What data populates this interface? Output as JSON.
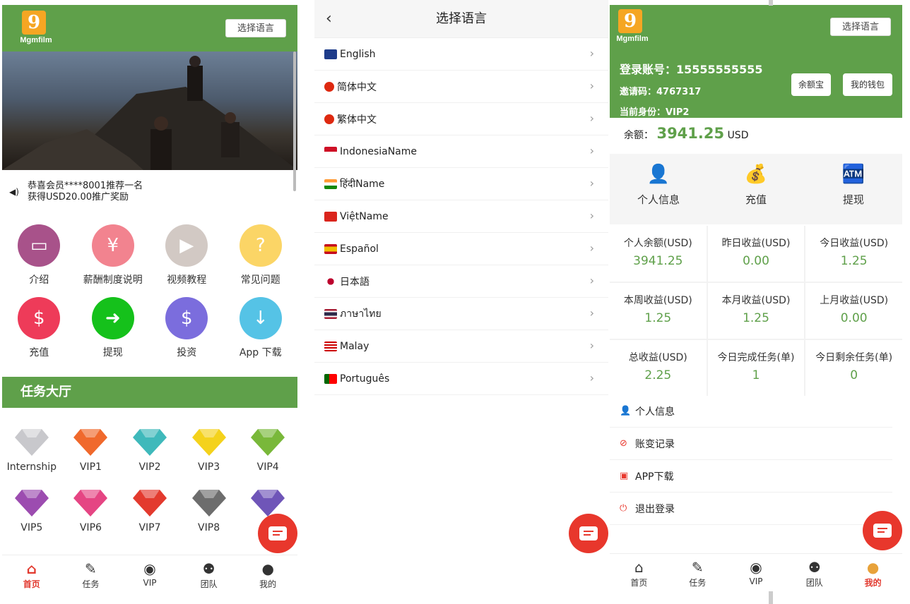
{
  "brand": {
    "logo_text": "Mgmfilm",
    "logo_glyph": "9"
  },
  "panel1": {
    "lang_button": "选择语言",
    "notice_line1": "恭喜会员****8001推荐一名",
    "notice_line2": "获得USD20.00推广奖励",
    "icons_row1": [
      {
        "label": "介绍",
        "color": "#a8528a",
        "icon": "monitor-icon",
        "glyph": "▭"
      },
      {
        "label": "薪酬制度说明",
        "color": "#f2838f",
        "icon": "salary-icon",
        "glyph": "¥"
      },
      {
        "label": "视频教程",
        "color": "#d2c9c4",
        "icon": "video-icon",
        "glyph": "▶"
      },
      {
        "label": "常见问题",
        "color": "#fbd566",
        "icon": "question-icon",
        "glyph": "?"
      }
    ],
    "icons_row2": [
      {
        "label": "充值",
        "color": "#ee3b59",
        "icon": "recharge-icon",
        "glyph": "$"
      },
      {
        "label": "提现",
        "color": "#15c11b",
        "icon": "withdraw-icon",
        "glyph": "➜"
      },
      {
        "label": "投资",
        "color": "#7b6ddd",
        "icon": "invest-icon",
        "glyph": "$"
      },
      {
        "label": "App 下载",
        "color": "#55c3e6",
        "icon": "download-icon",
        "glyph": "↓"
      }
    ],
    "section_title": "任务大厅",
    "gems_row1": [
      {
        "label": "Internship",
        "color": "#c8c8cc"
      },
      {
        "label": "VIP1",
        "color": "#f0692c"
      },
      {
        "label": "VIP2",
        "color": "#3fb9bb"
      },
      {
        "label": "VIP3",
        "color": "#f4d21c"
      },
      {
        "label": "VIP4",
        "color": "#79b83a"
      }
    ],
    "gems_row2": [
      {
        "label": "VIP5",
        "color": "#9c4cb0"
      },
      {
        "label": "VIP6",
        "color": "#e54583"
      },
      {
        "label": "VIP7",
        "color": "#e33a2e"
      },
      {
        "label": "VIP8",
        "color": "#6d6d6d"
      },
      {
        "label": "V",
        "color": "#6f55b8"
      }
    ],
    "nav": [
      {
        "label": "首页",
        "icon": "home-icon",
        "glyph": "⌂",
        "active": true
      },
      {
        "label": "任务",
        "icon": "task-icon",
        "glyph": "✎",
        "active": false
      },
      {
        "label": "VIP",
        "icon": "vip-icon",
        "glyph": "◉",
        "active": false
      },
      {
        "label": "团队",
        "icon": "team-icon",
        "glyph": "⚉",
        "active": false
      },
      {
        "label": "我的",
        "icon": "profile-icon",
        "glyph": "●",
        "active": false
      }
    ]
  },
  "panel2": {
    "title": "选择语言",
    "languages": [
      {
        "label": "English",
        "flag": "#1e3c8a"
      },
      {
        "label": "简体中文",
        "flag": "#de2910"
      },
      {
        "label": "繁体中文",
        "flag": "#de2910"
      },
      {
        "label": "IndonesiaName",
        "flag": "#ce1126"
      },
      {
        "label": "हिंदीName",
        "flag": "#ff9933"
      },
      {
        "label": "ViệtName",
        "flag": "#da251d"
      },
      {
        "label": "Español",
        "flag": "#f1bf00"
      },
      {
        "label": "日本語",
        "flag": "#bc002d"
      },
      {
        "label": "ภาษาไทย",
        "flag": "#2d2a4a"
      },
      {
        "label": "Malay",
        "flag": "#010066"
      },
      {
        "label": "Português",
        "flag": "#006600"
      }
    ]
  },
  "panel3": {
    "lang_button": "选择语言",
    "account": "登录账号：15555555555",
    "invite": "邀请码：4767317",
    "identity": "当前身份：VIP2",
    "btn_yuebao": "余额宝",
    "btn_wallet": "我的钱包",
    "balance_label": "余额：",
    "balance_value": "3941.25",
    "balance_unit": "USD",
    "quick": [
      {
        "label": "个人信息",
        "icon": "user-icon",
        "glyph": "👤"
      },
      {
        "label": "充值",
        "icon": "coin-hand-icon",
        "glyph": "💰"
      },
      {
        "label": "提现",
        "icon": "cash-register-icon",
        "glyph": "🏧"
      }
    ],
    "stats": [
      {
        "k": "个人余额(USD)",
        "v": "3941.25"
      },
      {
        "k": "昨日收益(USD)",
        "v": "0.00"
      },
      {
        "k": "今日收益(USD)",
        "v": "1.25"
      },
      {
        "k": "本周收益(USD)",
        "v": "1.25"
      },
      {
        "k": "本月收益(USD)",
        "v": "1.25"
      },
      {
        "k": "上月收益(USD)",
        "v": "0.00"
      },
      {
        "k": "总收益(USD)",
        "v": "2.25"
      },
      {
        "k": "今日完成任务(单)",
        "v": "1"
      },
      {
        "k": "今日剩余任务(单)",
        "v": "0"
      }
    ],
    "menu": [
      {
        "label": "个人信息",
        "icon": "user-icon",
        "glyph": "👤"
      },
      {
        "label": "账变记录",
        "icon": "record-icon",
        "glyph": "⊘"
      },
      {
        "label": "APP下载",
        "icon": "app-icon",
        "glyph": "▣"
      },
      {
        "label": "退出登录",
        "icon": "power-icon",
        "glyph": "⏻"
      }
    ],
    "nav": [
      {
        "label": "首页",
        "icon": "home-icon",
        "glyph": "⌂",
        "active": false
      },
      {
        "label": "任务",
        "icon": "task-icon",
        "glyph": "✎",
        "active": false
      },
      {
        "label": "VIP",
        "icon": "vip-icon",
        "glyph": "◉",
        "active": false
      },
      {
        "label": "团队",
        "icon": "team-icon",
        "glyph": "⚉",
        "active": false
      },
      {
        "label": "我的",
        "icon": "profile-icon",
        "glyph": "●",
        "active": true
      }
    ]
  }
}
